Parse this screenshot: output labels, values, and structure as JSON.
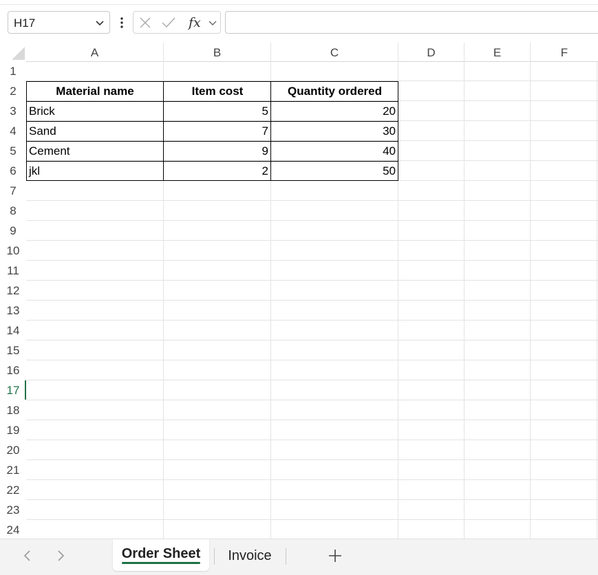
{
  "formula_bar": {
    "name_box": "H17",
    "formula_value": ""
  },
  "columns": [
    "A",
    "B",
    "C",
    "D",
    "E",
    "F"
  ],
  "rows": [
    "1",
    "2",
    "3",
    "4",
    "5",
    "6",
    "7",
    "8",
    "9",
    "10",
    "11",
    "12",
    "13",
    "14",
    "15",
    "16",
    "17",
    "18",
    "19",
    "20",
    "21",
    "22",
    "23",
    "24"
  ],
  "selected_row": "17",
  "table": {
    "headers": [
      "Material name",
      "Item cost",
      "Quantity ordered"
    ],
    "rows": [
      [
        "Brick",
        "5",
        "20"
      ],
      [
        "Sand",
        "7",
        "30"
      ],
      [
        "Cement",
        "9",
        "40"
      ],
      [
        "jkl",
        "2",
        "50"
      ]
    ]
  },
  "sheet_tabs": {
    "tabs": [
      "Order Sheet",
      "Invoice"
    ],
    "active": "Order Sheet"
  },
  "colors": {
    "accent": "#1e7145",
    "gridline": "#e3e3e3",
    "header_text": "#444444"
  },
  "icons": [
    "chevron-down-icon",
    "more-vertical-icon",
    "cancel-x-icon",
    "check-icon",
    "fx-icon",
    "chevron-left-icon",
    "chevron-right-icon",
    "plus-icon"
  ]
}
